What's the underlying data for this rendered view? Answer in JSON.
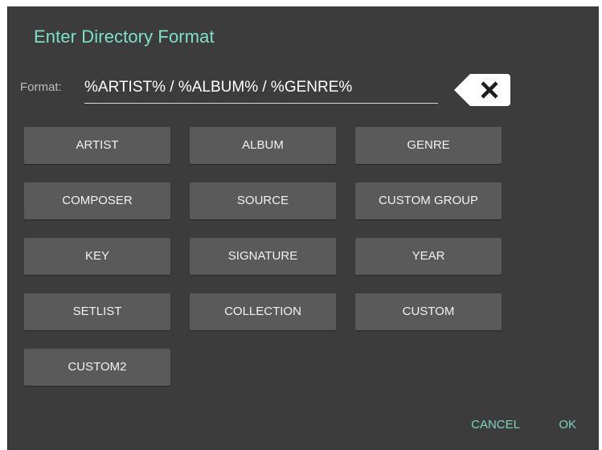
{
  "dialog": {
    "title": "Enter Directory Format"
  },
  "format": {
    "label": "Format:",
    "value": "%ARTIST% / %ALBUM% / %GENRE%",
    "clear_icon": "backspace-clear-icon"
  },
  "tokens": [
    "ARTIST",
    "ALBUM",
    "GENRE",
    "COMPOSER",
    "SOURCE",
    "CUSTOM GROUP",
    "KEY",
    "SIGNATURE",
    "YEAR",
    "SETLIST",
    "COLLECTION",
    "CUSTOM",
    "CUSTOM2"
  ],
  "actions": {
    "cancel": "CANCEL",
    "ok": "OK"
  },
  "colors": {
    "accent": "#7fe0c8",
    "dialog_bg": "#3c3c3c",
    "button_bg": "#5a5a5a"
  }
}
